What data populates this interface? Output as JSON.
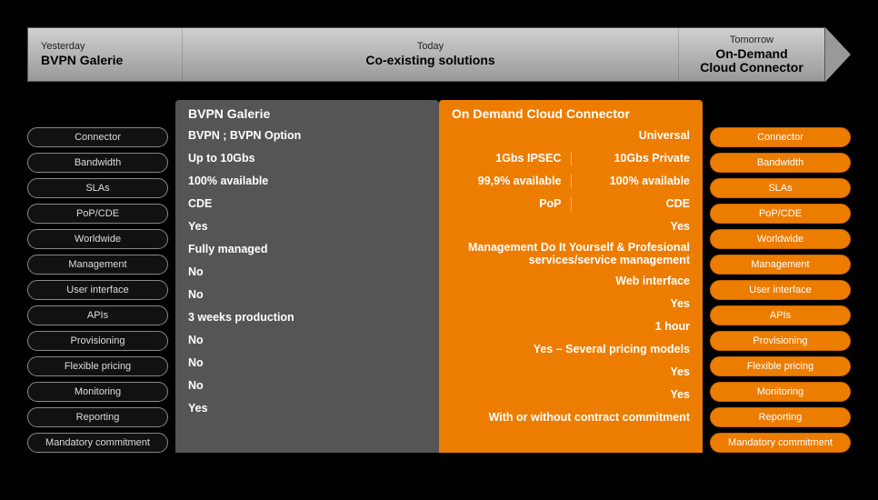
{
  "timeline": {
    "yesterday": {
      "label": "Yesterday",
      "value": "BVPN Galerie"
    },
    "today": {
      "label": "Today",
      "value": "Co-existing solutions"
    },
    "tomorrow": {
      "label": "Tomorrow",
      "value": "On-Demand\nCloud Connector"
    }
  },
  "categories": [
    "Connector",
    "Bandwidth",
    "SLAs",
    "PoP/CDE",
    "Worldwide",
    "Management",
    "User interface",
    "APIs",
    "Provisioning",
    "Flexible pricing",
    "Monitoring",
    "Reporting",
    "Mandatory commitment"
  ],
  "columns": {
    "left": {
      "title": "BVPN Galerie",
      "rows": [
        "BVPN ; BVPN Option",
        "Up to 10Gbs",
        "100% available",
        "CDE",
        "Yes",
        "Fully managed",
        "No",
        "No",
        "3 weeks production",
        "No",
        "No",
        "No",
        "Yes"
      ]
    },
    "right": {
      "title": "On Demand Cloud Connector",
      "rows": [
        {
          "type": "single",
          "value": "Universal"
        },
        {
          "type": "split",
          "a": "1Gbs IPSEC",
          "b": "10Gbs Private"
        },
        {
          "type": "split",
          "a": "99,9% available",
          "b": "100% available"
        },
        {
          "type": "split",
          "a": "PoP",
          "b": "CDE"
        },
        {
          "type": "single",
          "value": "Yes"
        },
        {
          "type": "single",
          "value": "Management Do It Yourself & Profesional services/service management"
        },
        {
          "type": "single",
          "value": "Web interface"
        },
        {
          "type": "single",
          "value": "Yes"
        },
        {
          "type": "single",
          "value": "1 hour"
        },
        {
          "type": "single",
          "value": "Yes – Several pricing models"
        },
        {
          "type": "single",
          "value": "Yes"
        },
        {
          "type": "single",
          "value": "Yes"
        },
        {
          "type": "single",
          "value": "With or without contract commitment"
        }
      ]
    }
  },
  "colors": {
    "orange": "#ed7d00",
    "grey": "#555555"
  }
}
